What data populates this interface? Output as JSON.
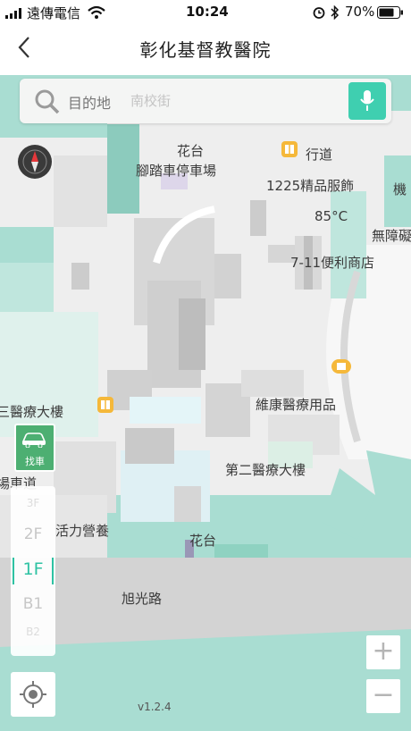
{
  "status_bar": {
    "carrier": "遠傳電信",
    "time": "10:24",
    "battery": "70%"
  },
  "header": {
    "title": "彰化基督教醫院"
  },
  "search": {
    "label": "目的地",
    "placeholder": "南校街"
  },
  "map_labels": {
    "flower_bed_top": "花台",
    "walkway": "行道",
    "bike_parking": "腳踏車停車場",
    "clothing_shop": "1225精品服飾",
    "machine": "機",
    "cafe": "85°C",
    "accessible": "無障礙",
    "convenience_store": "7-11便利商店",
    "third_building": "三醫療大樓",
    "medical_supply": "維康醫療用品",
    "car_lane": "場車道",
    "second_building": "第二醫療大樓",
    "nutrition": "活力營養",
    "flower_bed_bottom": "花台",
    "road": "旭光路"
  },
  "find_car": {
    "label": "找車"
  },
  "floors": [
    "3F",
    "2F",
    "1F",
    "B1",
    "B2"
  ],
  "selected_floor": "1F",
  "zoom": {
    "in": "+",
    "out": "−"
  },
  "version": "v1.2.4",
  "colors": {
    "accent": "#3fcfb0",
    "map_bg": "#a9ddd2",
    "find_car": "#4daf72"
  }
}
